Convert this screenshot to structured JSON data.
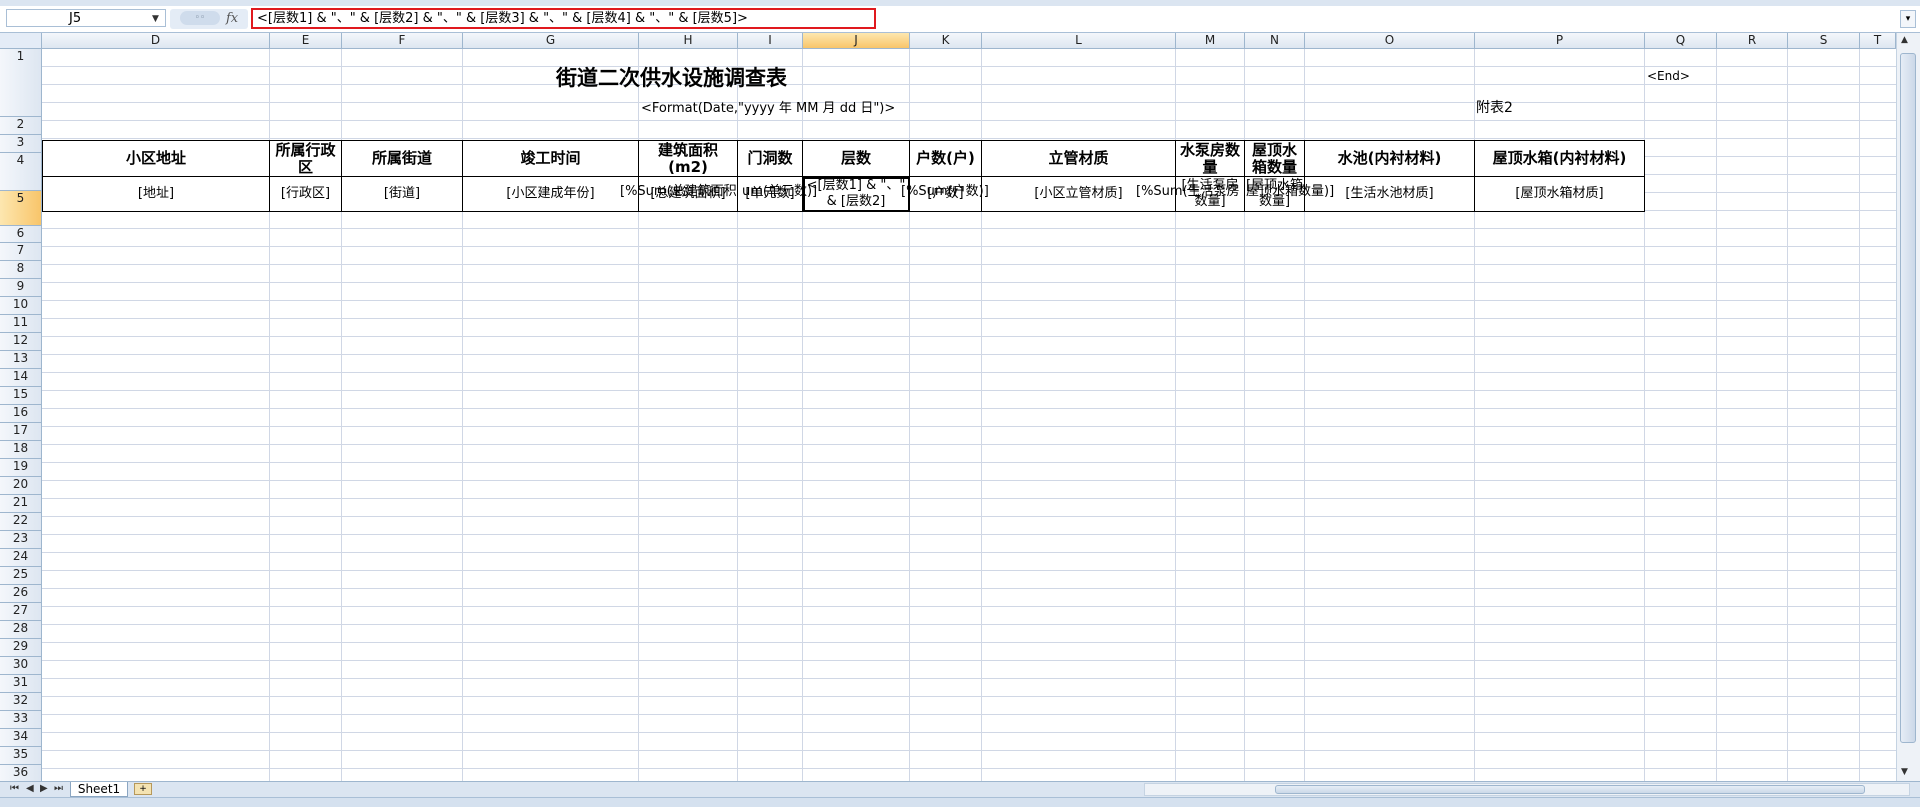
{
  "formula_bar": {
    "name_box": "J5",
    "fx_label": "fx",
    "formula": "<[层数1] & \"、\" & [层数2] & \"、\" & [层数3] & \"、\" & [层数4] & \"、\" & [层数5]>"
  },
  "columns": [
    "D",
    "E",
    "F",
    "G",
    "H",
    "I",
    "J",
    "K",
    "L",
    "M",
    "N",
    "O",
    "P",
    "Q",
    "R",
    "S",
    "T"
  ],
  "rows": [
    "1",
    "2",
    "3",
    "4",
    "5",
    "6",
    "7",
    "8",
    "9",
    "10",
    "11",
    "12",
    "13",
    "14",
    "15",
    "16",
    "17",
    "18",
    "19",
    "20",
    "21",
    "22",
    "23",
    "24",
    "25",
    "26",
    "27",
    "28",
    "29",
    "30",
    "31",
    "32",
    "33",
    "34",
    "35",
    "36"
  ],
  "sheet": {
    "title": "街道二次供水设施调查表",
    "end_marker": "<End>",
    "date_format": "<Format(Date,\"yyyy 年 MM 月 dd 日\")>",
    "appendix": "附表2",
    "headers": [
      "小区地址",
      "所属行政区",
      "所属街道",
      "竣工时间",
      "建筑面积(m2)",
      "门洞数",
      "层数",
      "户数(户)",
      "立管材质",
      "水泵房数量",
      "屋顶水箱数量",
      "水池(内衬材料)",
      "屋顶水箱(内衬材料)"
    ],
    "row5": [
      "[地址]",
      "[行政区]",
      "[街道]",
      "[小区建成年份]",
      "[总建筑面积]",
      "[单元数]",
      "<[层数1] & \"、\" & [层数2]",
      "[户数]",
      "[小区立管材质]",
      "[生活泵房数量]",
      "[屋顶水箱数量]",
      "[生活水池材质]",
      "[屋顶水箱材质]"
    ],
    "sum_area": "[%Sum(总建筑面积",
    "sum_units": "um(单元数)]",
    "sum_households": "[%Sum(户数)]",
    "sum_pumps": "[%Sum(生活泵房",
    "sum_tanks": "屋顶水箱数量)]"
  },
  "tabs": {
    "sheet1": "Sheet1"
  }
}
